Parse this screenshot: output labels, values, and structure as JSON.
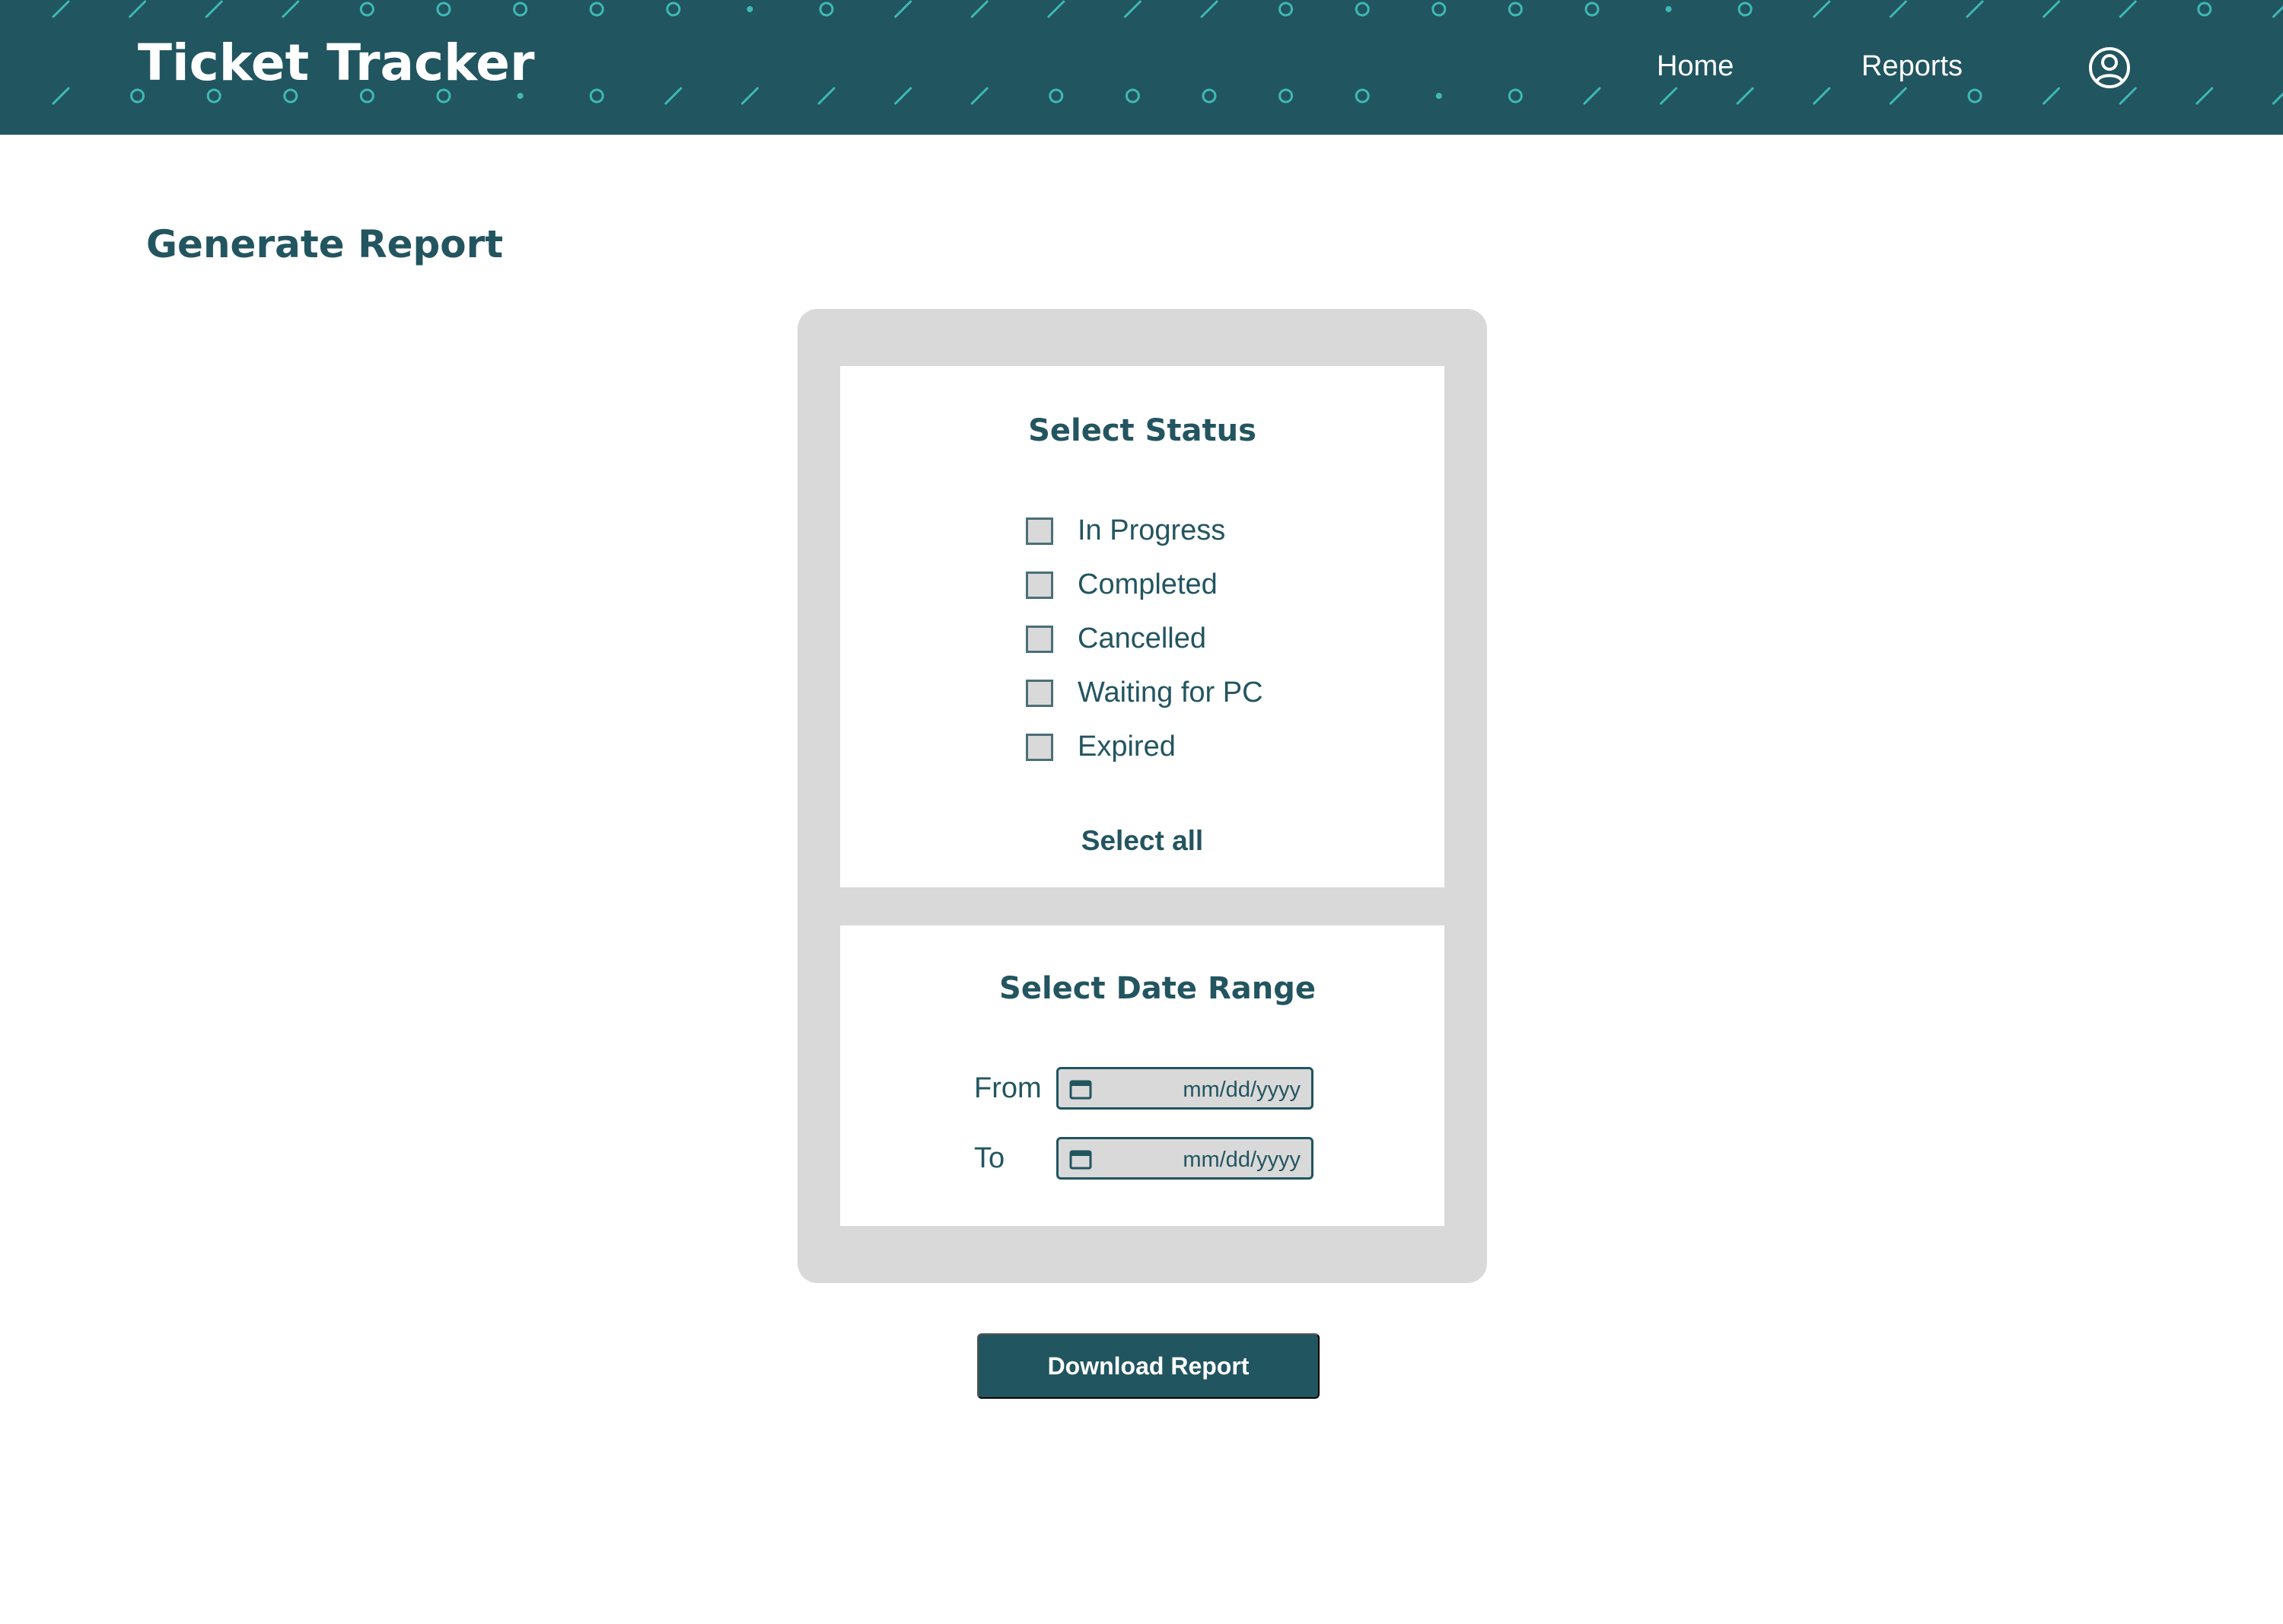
{
  "colors": {
    "brand": "#215560",
    "pattern": "#3fb9b4",
    "card_background": "#d9d9d9",
    "panel_background": "#ffffff"
  },
  "header": {
    "app_title": "Ticket Tracker",
    "nav": {
      "home_label": "Home",
      "reports_label": "Reports"
    },
    "account_icon": "user-circle-icon"
  },
  "main": {
    "page_title": "Generate Report",
    "status_section": {
      "heading": "Select Status",
      "options": [
        {
          "label": "In Progress",
          "checked": false
        },
        {
          "label": "Completed",
          "checked": false
        },
        {
          "label": "Cancelled",
          "checked": false
        },
        {
          "label": "Waiting for PC",
          "checked": false
        },
        {
          "label": "Expired",
          "checked": false
        }
      ],
      "select_all_label": "Select all"
    },
    "date_section": {
      "heading": "Select Date Range",
      "from_label": "From",
      "to_label": "To",
      "from_placeholder": "mm/dd/yyyy",
      "to_placeholder": "mm/dd/yyyy",
      "calendar_icon": "calendar-icon"
    },
    "download_button_label": "Download Report"
  }
}
